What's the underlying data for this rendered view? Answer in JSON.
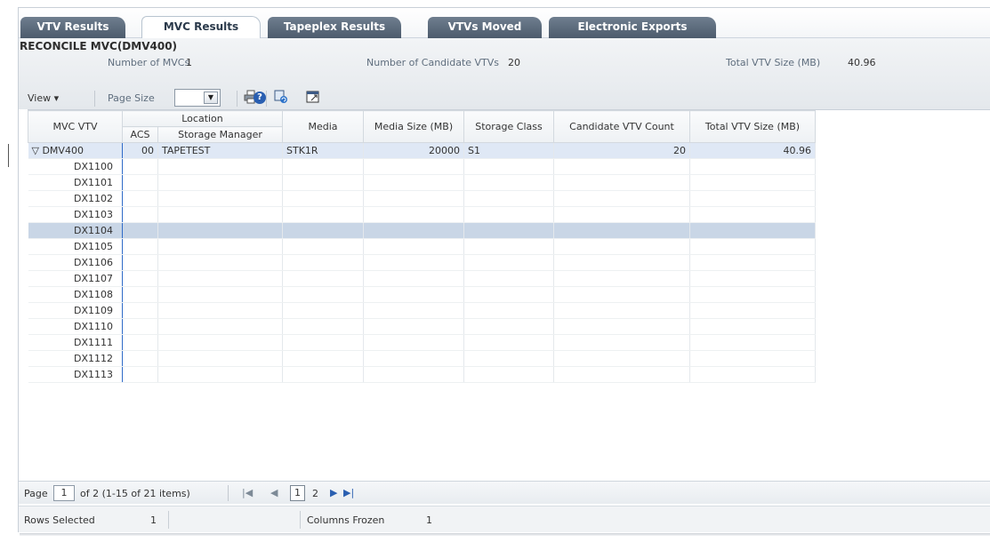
{
  "tabs": [
    {
      "label": "VTV Results"
    },
    {
      "label": "MVC Results"
    },
    {
      "label": "Tapeplex Results"
    },
    {
      "label": "VTVs Moved"
    },
    {
      "label": "Electronic Exports"
    }
  ],
  "header": {
    "title": "RECONCILE MVC(DMV400)",
    "num_mvcs_label": "Number of MVCs",
    "num_mvcs_value": "1",
    "candidate_label": "Number of Candidate VTVs",
    "candidate_value": "20",
    "total_size_label": "Total VTV Size (MB)",
    "total_size_value": "40.96"
  },
  "toolbar": {
    "view_label": "View ▾",
    "page_size_label": "Page Size",
    "page_size_value": "",
    "print_icon": "print-icon",
    "refresh_icon": "refresh-icon",
    "detach_icon": "detach-icon",
    "help_icon": "help-icon"
  },
  "table": {
    "columns": {
      "mvc_vtv": "MVC VTV",
      "location": "Location",
      "acs": "ACS",
      "storage_manager": "Storage Manager",
      "media": "Media",
      "media_size": "Media Size (MB)",
      "storage_class": "Storage Class",
      "candidate_count": "Candidate VTV Count",
      "total_size": "Total VTV Size (MB)"
    },
    "parent_row": {
      "mvc_vtv": "▽ DMV400",
      "acs": "00",
      "storage_manager": "TAPETEST",
      "media": "STK1R",
      "media_size": "20000",
      "storage_class": "S1",
      "candidate_count": "20",
      "total_size": "40.96"
    },
    "child_rows": [
      "DX1100",
      "DX1101",
      "DX1102",
      "DX1103",
      "DX1104",
      "DX1105",
      "DX1106",
      "DX1107",
      "DX1108",
      "DX1109",
      "DX1110",
      "DX1111",
      "DX1112",
      "DX1113"
    ],
    "selected_row": "DX1104"
  },
  "pager": {
    "page_label": "Page",
    "page_value": "1",
    "of_text": "of 2 (1-15 of 21 items)",
    "first_icon": "first-page-icon",
    "prev_icon": "prev-page-icon",
    "page_1": "1",
    "page_2": "2",
    "next_icon": "next-page-icon",
    "last_icon": "last-page-icon"
  },
  "status": {
    "rows_selected_label": "Rows Selected",
    "rows_selected_value": "1",
    "columns_frozen_label": "Columns Frozen",
    "columns_frozen_value": "1"
  }
}
